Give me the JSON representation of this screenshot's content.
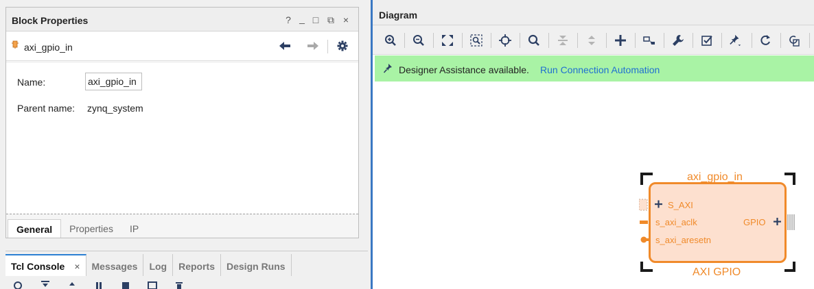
{
  "block_properties": {
    "title": "Block Properties",
    "header_controls": [
      "?",
      "_",
      "□",
      "⧉",
      "×"
    ],
    "block_name": "axi_gpio_in",
    "name_label": "Name:",
    "name_value": "axi_gpio_in",
    "parent_label": "Parent name:",
    "parent_value": "zynq_system",
    "tabs": [
      {
        "label": "General",
        "active": true
      },
      {
        "label": "Properties",
        "active": false
      },
      {
        "label": "IP",
        "active": false
      }
    ]
  },
  "bottom_panel": {
    "tabs": [
      {
        "label": "Tcl Console",
        "active": true,
        "close": "×"
      },
      {
        "label": "Messages",
        "active": false
      },
      {
        "label": "Log",
        "active": false
      },
      {
        "label": "Reports",
        "active": false
      },
      {
        "label": "Design Runs",
        "active": false
      }
    ]
  },
  "diagram": {
    "title": "Diagram",
    "toolbar_icons": [
      "zoom-in-icon",
      "zoom-out-icon",
      "zoom-fit-icon",
      "zoom-area-icon",
      "center-icon",
      "search-icon",
      "collapse-icon",
      "expand-icon",
      "add-ip-icon",
      "make-connection-icon",
      "properties-wrench-icon",
      "validate-icon",
      "pin-icon",
      "refresh-icon",
      "regenerate-layout-icon"
    ],
    "banner": {
      "text": "Designer Assistance available.",
      "link": "Run Connection Automation"
    },
    "block": {
      "instance_name": "axi_gpio_in",
      "ip_name": "AXI GPIO",
      "ports_left": [
        "S_AXI",
        "s_axi_aclk",
        "s_axi_aresetn"
      ],
      "ports_right": [
        "GPIO"
      ],
      "fill_color": "#fde0cf",
      "border_color": "#f08a2a"
    }
  },
  "colors": {
    "accent": "#2a7fd2",
    "banner_bg": "#a9f3a5",
    "link": "#1f6fd1",
    "block_orange": "#f08a2a"
  }
}
